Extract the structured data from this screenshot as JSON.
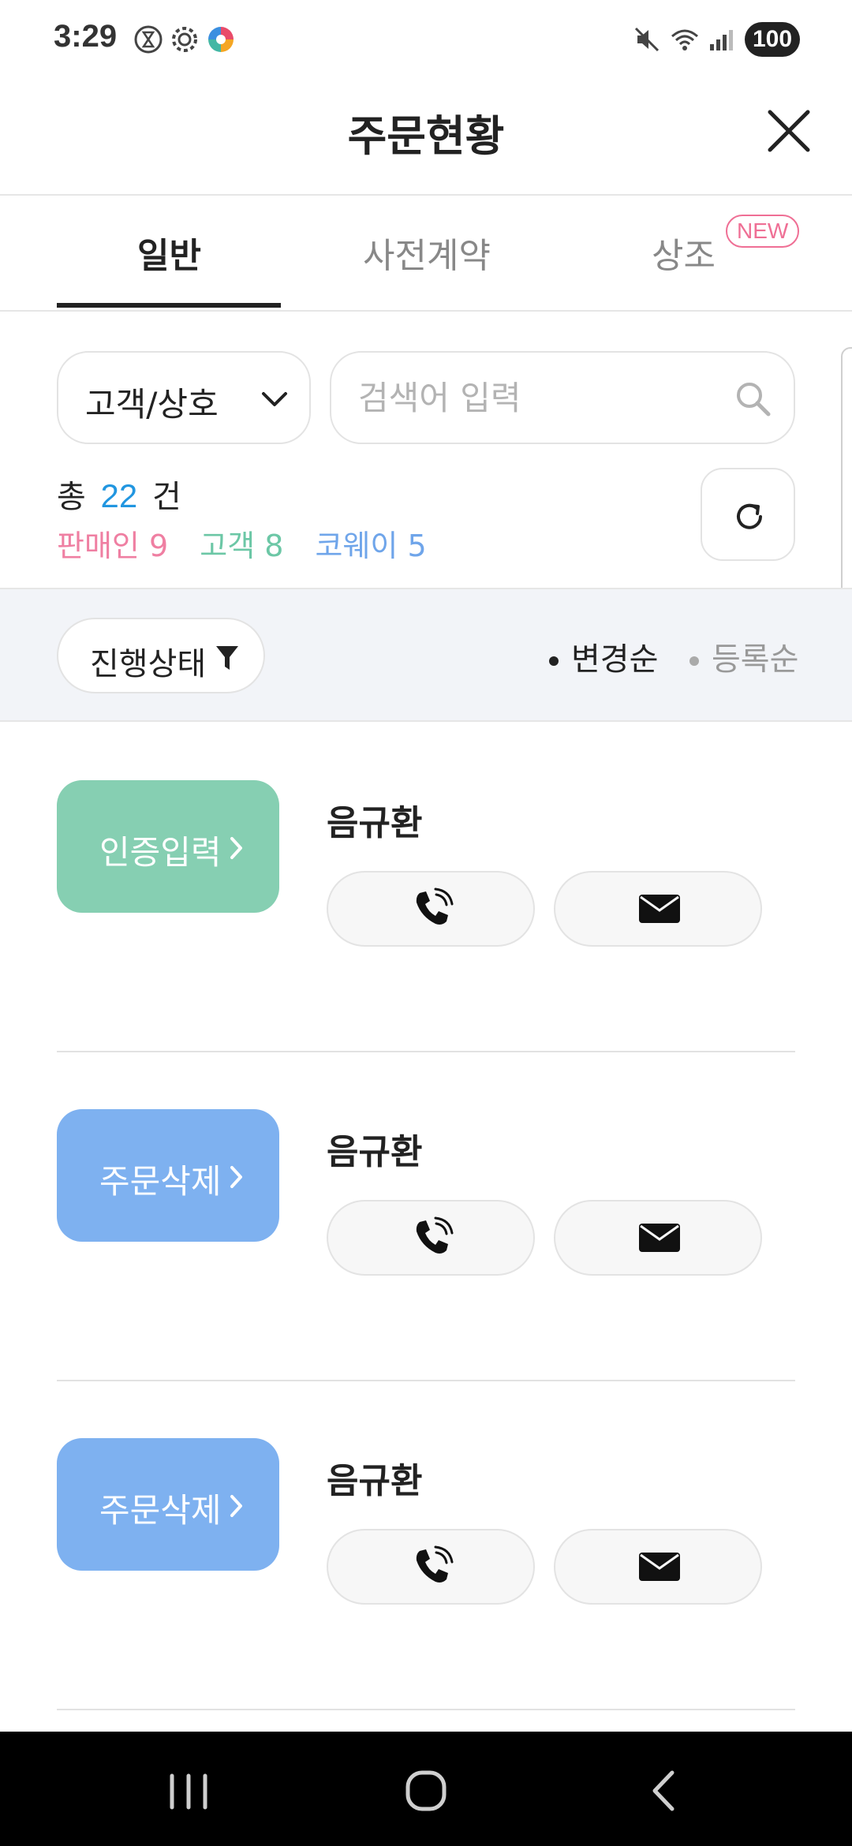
{
  "status_bar": {
    "time": "3:29",
    "battery": "100"
  },
  "header": {
    "title": "주문현황"
  },
  "tabs": [
    {
      "label": "일반",
      "active": true
    },
    {
      "label": "사전계약",
      "active": false
    },
    {
      "label": "상조",
      "active": false,
      "badge": "NEW"
    }
  ],
  "search": {
    "category": "고객/상호",
    "placeholder": "검색어 입력"
  },
  "summary": {
    "total_prefix": "총",
    "total_count": "22",
    "total_suffix": "건",
    "seller": "판매인 9",
    "customer": "고객 8",
    "coway": "코웨이 5"
  },
  "filter": {
    "status_label": "진행상태",
    "sort_options": [
      {
        "label": "변경순",
        "selected": true
      },
      {
        "label": "등록순",
        "selected": false
      }
    ]
  },
  "orders": [
    {
      "status": "인증입력",
      "status_color": "#86cfb2",
      "name": "음규환"
    },
    {
      "status": "주문삭제",
      "status_color": "#7eb1f0",
      "name": "음규환"
    },
    {
      "status": "주문삭제",
      "status_color": "#7eb1f0",
      "name": "음규환"
    }
  ],
  "colors": {
    "accent_blue": "#2196e0",
    "seller_pink": "#ef7fa2",
    "customer_green": "#6cc7a6",
    "coway_blue": "#6fa5ea",
    "new_badge": "#ef6f95"
  }
}
